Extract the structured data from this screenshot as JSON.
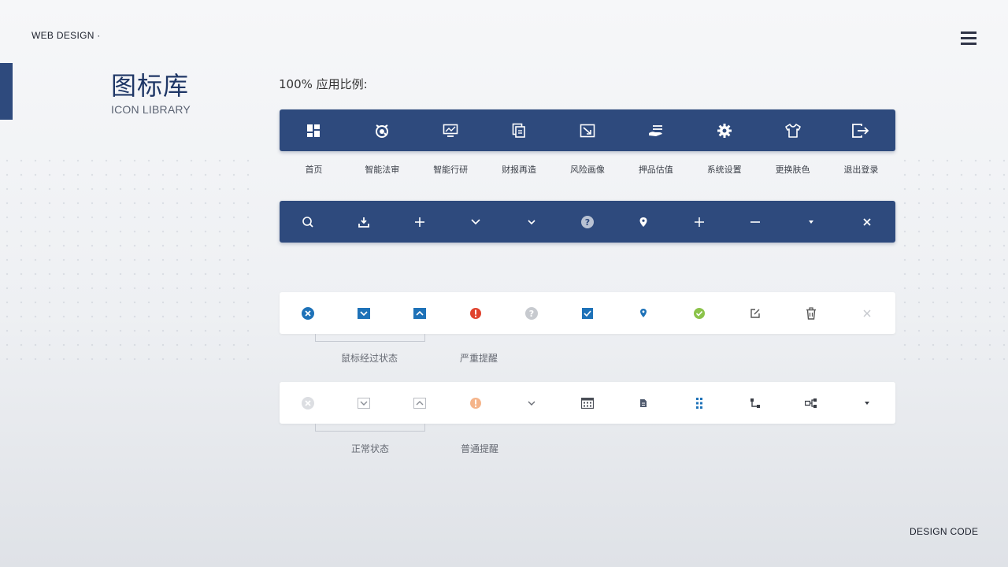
{
  "header": {
    "brand": "WEB DESIGN ·",
    "menu_icon": "hamburger-menu-icon"
  },
  "title": {
    "cn": "图标库",
    "en": "ICON LIBRARY"
  },
  "scale_label": "100% 应用比例:",
  "nav_bar": {
    "items": [
      {
        "label": "首页",
        "icon": "home-grid-icon"
      },
      {
        "label": "智能法审",
        "icon": "alarm-target-icon"
      },
      {
        "label": "智能行研",
        "icon": "monitor-chart-icon"
      },
      {
        "label": "财报再造",
        "icon": "documents-icon"
      },
      {
        "label": "风险画像",
        "icon": "image-arrow-icon"
      },
      {
        "label": "押品估值",
        "icon": "hand-stack-icon"
      },
      {
        "label": "系统设置",
        "icon": "gear-icon"
      },
      {
        "label": "更换肤色",
        "icon": "tshirt-icon"
      },
      {
        "label": "退出登录",
        "icon": "logout-icon"
      }
    ]
  },
  "tool_bar": {
    "icons": [
      "search-icon",
      "download-icon",
      "plus-icon",
      "chevron-down-icon",
      "chevron-down-small-icon",
      "question-circle-icon",
      "location-pin-icon",
      "plus-thin-icon",
      "minus-icon",
      "caret-down-icon",
      "close-icon"
    ]
  },
  "hover_bar": {
    "icons": [
      "close-circle-blue-icon",
      "chevron-down-box-blue-icon",
      "chevron-up-box-blue-icon",
      "alert-circle-red-icon",
      "question-circle-gray-icon",
      "checkbox-checked-blue-icon",
      "location-pin-blue-icon",
      "check-circle-green-icon",
      "edit-icon",
      "trash-icon",
      "close-light-icon"
    ]
  },
  "normal_bar": {
    "icons": [
      "close-circle-gray-icon",
      "chevron-down-box-gray-icon",
      "chevron-up-box-gray-icon",
      "alert-circle-orange-icon",
      "chevron-down-gray-icon",
      "calendar-grid-icon",
      "file-icon",
      "dots-grid-blue-icon",
      "flow-step-icon",
      "network-node-icon",
      "caret-down-dark-icon"
    ]
  },
  "states": {
    "hover": "鼠标经过状态",
    "severe_alert": "严重提醒",
    "normal": "正常状态",
    "normal_alert": "普通提醒"
  },
  "footer": {
    "design_code": "DESIGN CODE"
  },
  "colors": {
    "primary": "#2e4a7d",
    "accent_blue": "#1e72b8",
    "alert_red": "#e0432f",
    "alert_orange": "#f5b48a",
    "success_green": "#8bc34a"
  }
}
